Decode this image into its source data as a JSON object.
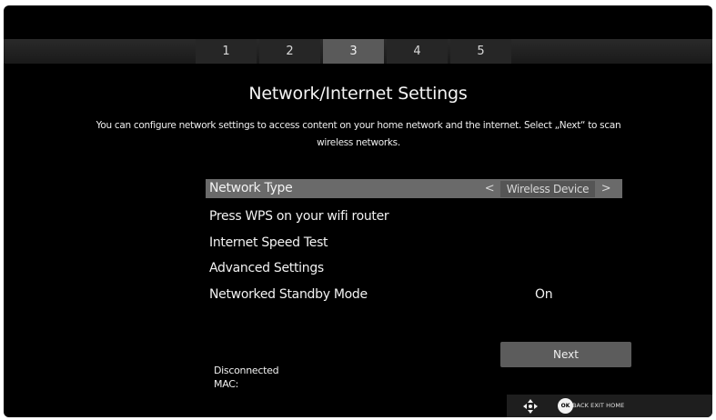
{
  "steps": [
    "1",
    "2",
    "3",
    "4",
    "5"
  ],
  "active_step": "3",
  "title": "Network/Internet Settings",
  "description": "You can configure network settings to access content on your home network and the internet. Select „Next“ to scan wireless networks.",
  "menu": {
    "network_type": {
      "label": "Network Type",
      "left_arrow": "<",
      "value": "Wireless Device",
      "right_arrow": ">"
    },
    "wps": {
      "label": "Press WPS on your wifi router"
    },
    "speed_test": {
      "label": "Internet Speed Test"
    },
    "advanced": {
      "label": "Advanced Settings"
    },
    "standby": {
      "label": "Networked Standby Mode",
      "value": "On"
    }
  },
  "next_label": "Next",
  "status": {
    "connection": "Disconnected",
    "mac": "MAC:"
  },
  "footer": {
    "ok_label": "OK",
    "hint": "BACK EXIT HOME"
  },
  "colors": {
    "background": "#000000",
    "step_active": "#5a5a5a",
    "selected_row": "#6a6a6a",
    "button": "#5c5c5c",
    "text": "#f2f2f2"
  },
  "icons": [
    "nav-arrows-icon",
    "ok-button-icon"
  ]
}
